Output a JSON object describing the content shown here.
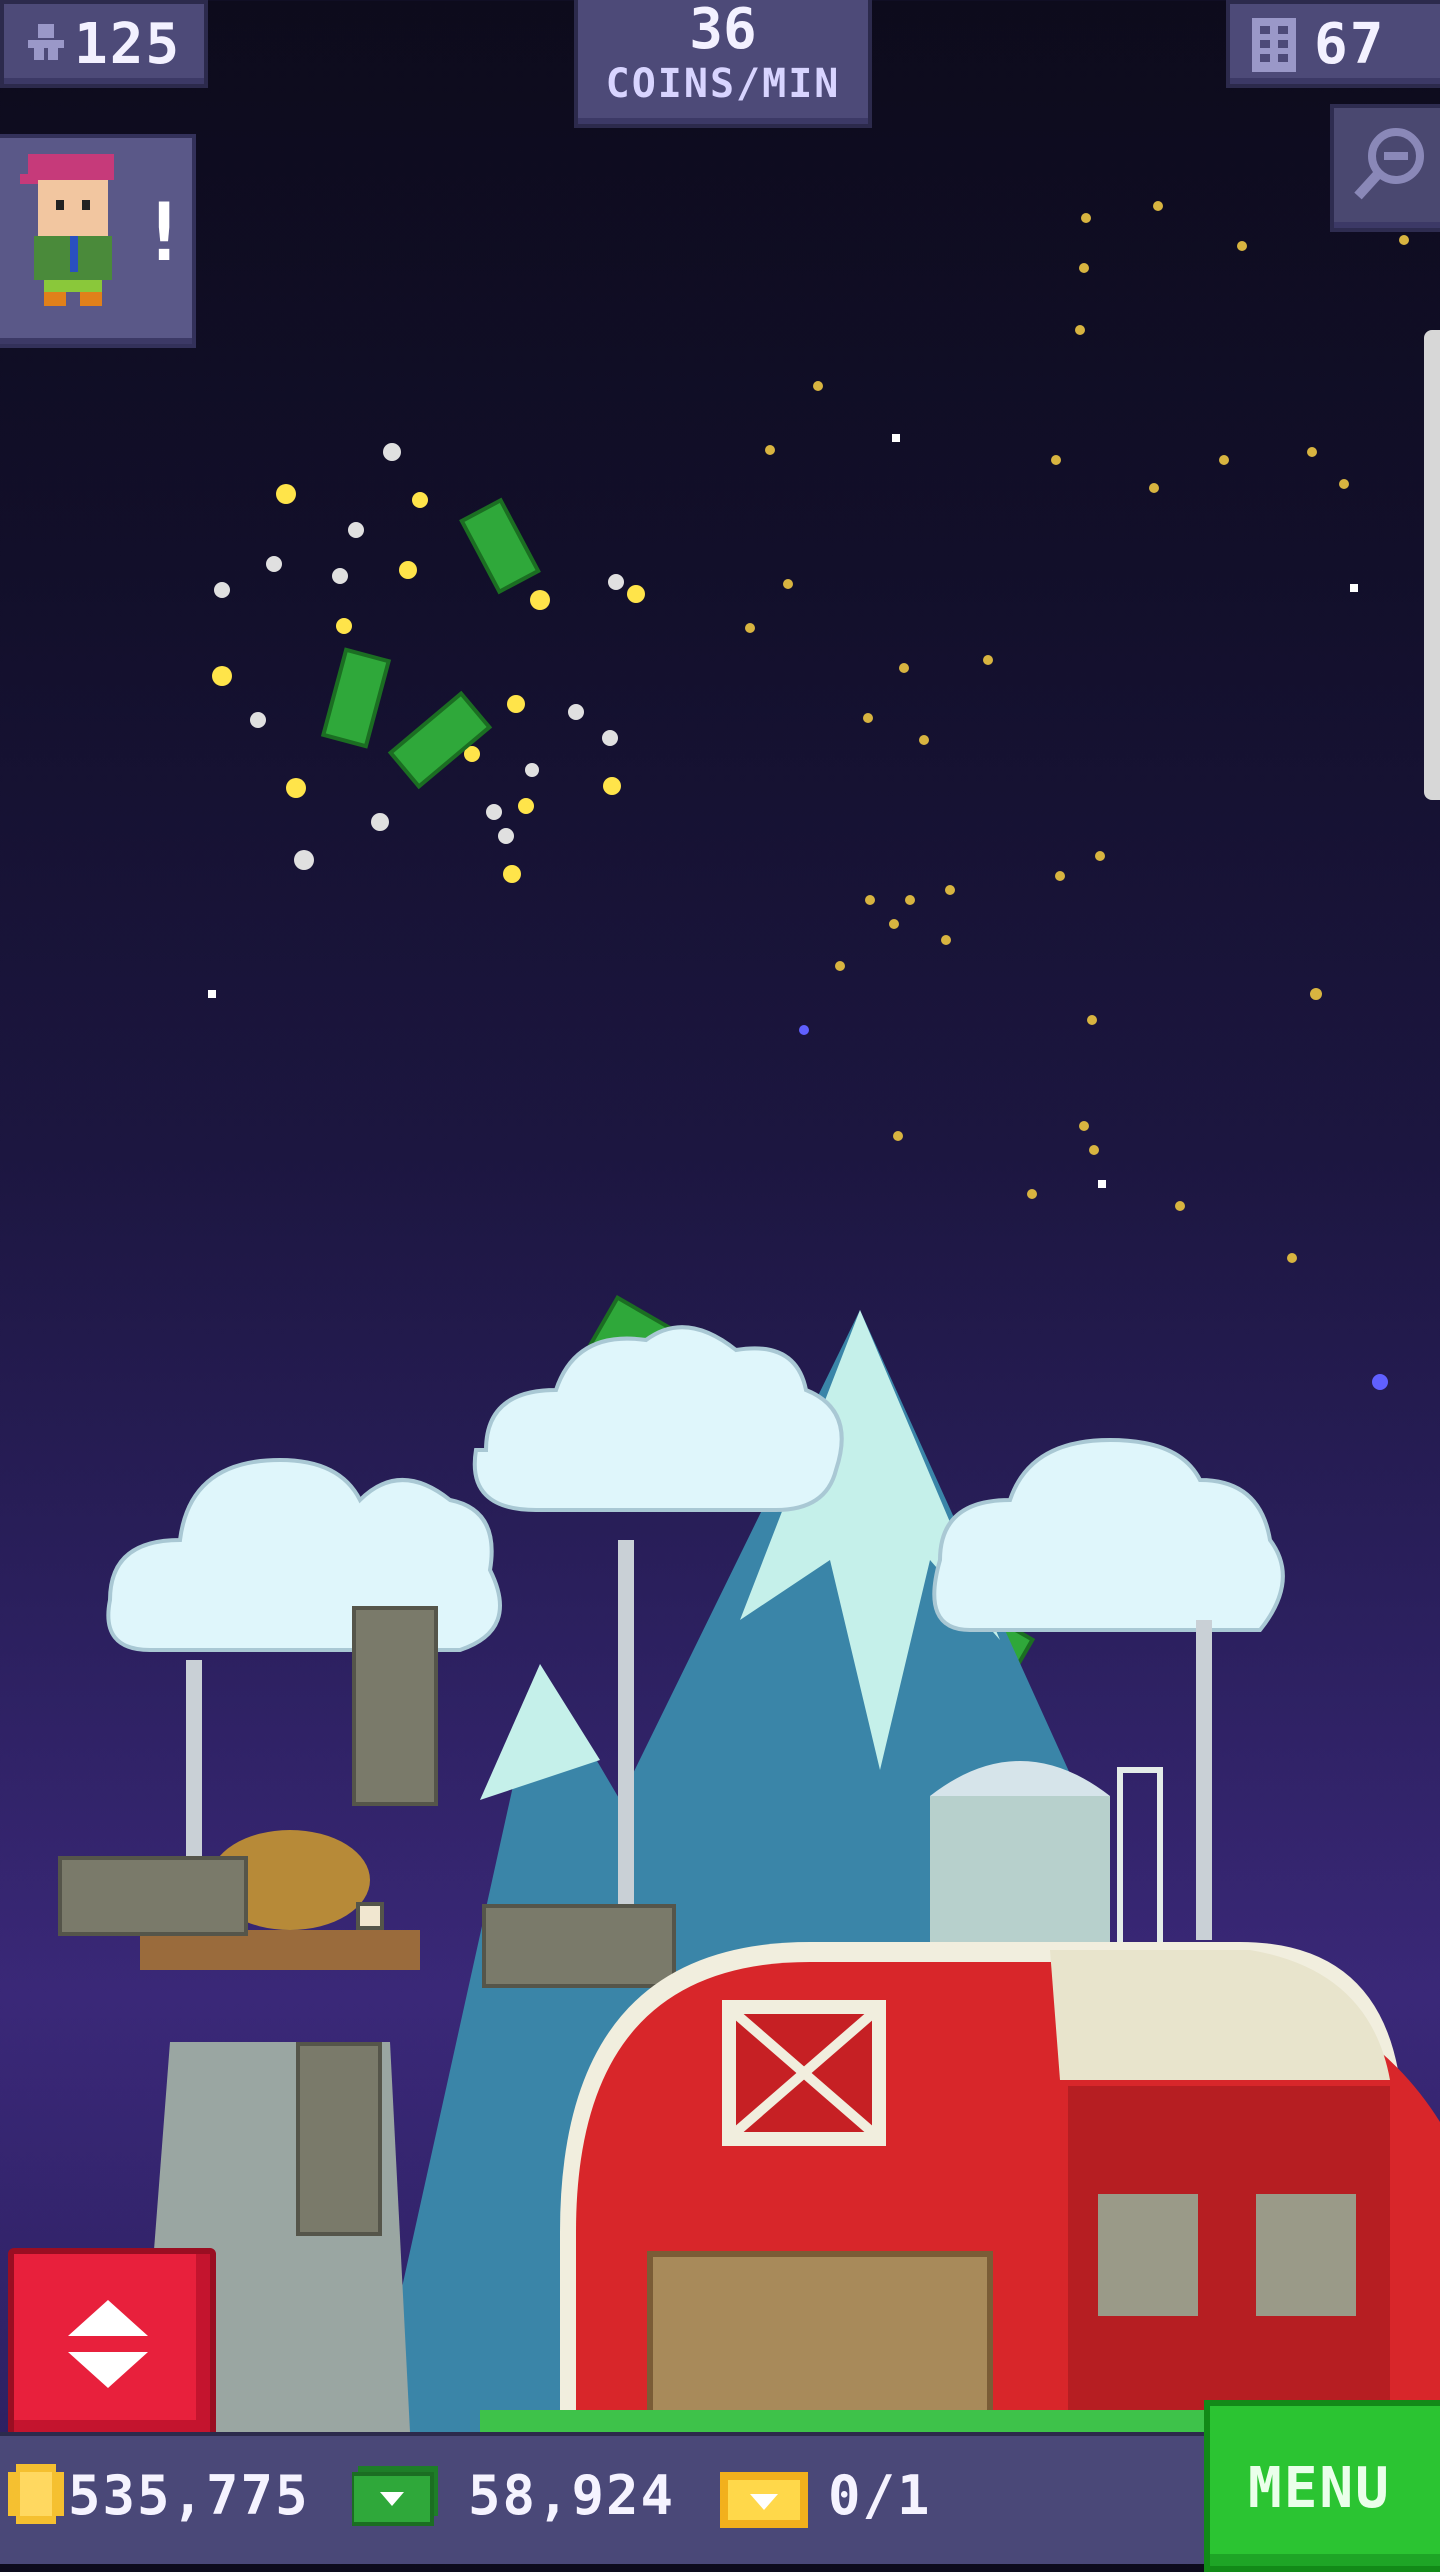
{
  "hud": {
    "population": "125",
    "coins_per_min_value": "36",
    "coins_per_min_unit": "COINS/MIN",
    "floors": "67"
  },
  "bottom_bar": {
    "coins": "535,775",
    "bux": "58,924",
    "vip": "0/1",
    "menu_label": "MENU"
  },
  "icons": {
    "population": "person-icon",
    "floors": "building-icon",
    "zoom": "magnifier-zoom-out-icon",
    "coins": "coin-icon",
    "bux": "bux-bill-icon",
    "vip": "vip-ticket-icon",
    "elevator": "elevator-up-down-icon",
    "notification": "exclamation-icon"
  },
  "colors": {
    "hud_panel": "#4d4a78",
    "menu_green": "#2bc432",
    "elevator_red": "#e8203c",
    "barn_red": "#d8262a",
    "bux_green": "#2fa83a"
  }
}
